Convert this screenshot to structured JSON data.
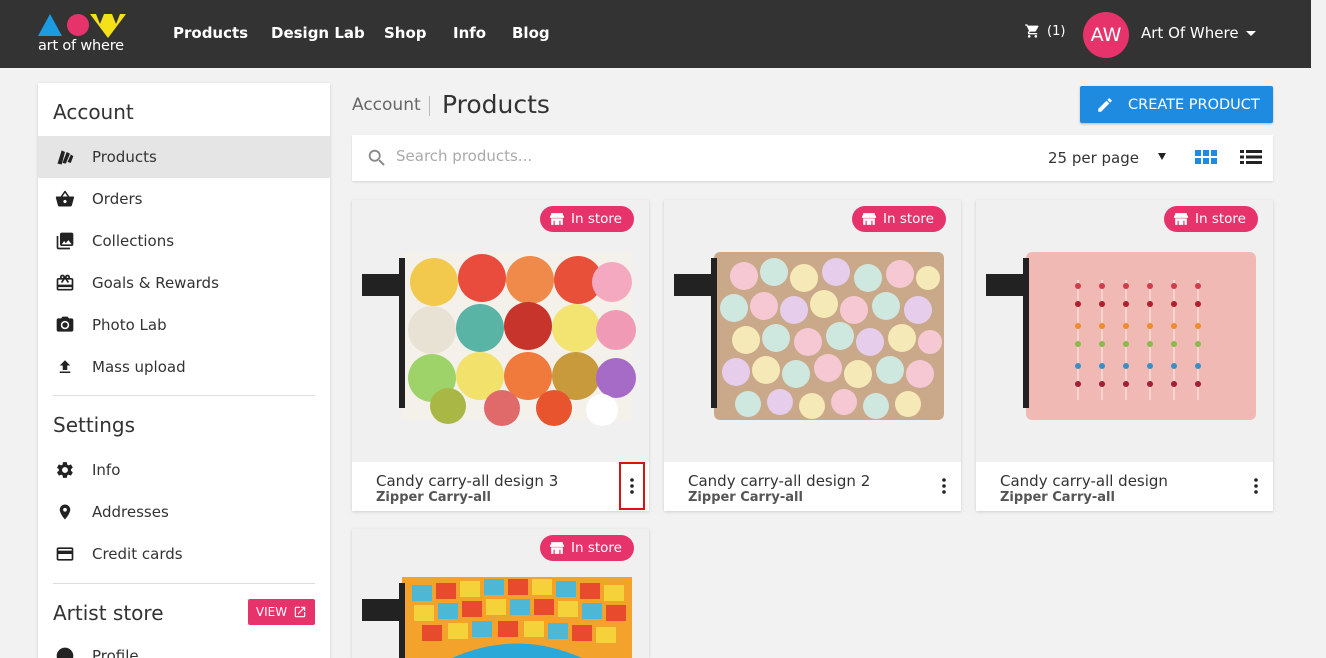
{
  "nav": {
    "logo_text": "art of where",
    "links": [
      "Products",
      "Design Lab",
      "Shop",
      "Info",
      "Blog"
    ],
    "cart_count": "(1)",
    "avatar_initials": "AW",
    "user_name": "Art Of Where"
  },
  "sidebar": {
    "account_heading": "Account",
    "account_items": [
      {
        "label": "Products",
        "icon": "swatch-icon",
        "active": true
      },
      {
        "label": "Orders",
        "icon": "basket-icon"
      },
      {
        "label": "Collections",
        "icon": "collections-icon"
      },
      {
        "label": "Goals & Rewards",
        "icon": "gift-icon"
      },
      {
        "label": "Photo Lab",
        "icon": "camera-icon"
      },
      {
        "label": "Mass upload",
        "icon": "upload-icon"
      }
    ],
    "settings_heading": "Settings",
    "settings_items": [
      {
        "label": "Info",
        "icon": "gear-icon"
      },
      {
        "label": "Addresses",
        "icon": "location-pin-icon"
      },
      {
        "label": "Credit cards",
        "icon": "credit-card-icon"
      }
    ],
    "store_heading": "Artist store",
    "view_label": "VIEW",
    "store_items": [
      {
        "label": "Profile",
        "icon": "profile-icon"
      }
    ]
  },
  "header": {
    "breadcrumb": "Account",
    "title": "Products",
    "create_label": "CREATE PRODUCT"
  },
  "search": {
    "placeholder": "Search products...",
    "per_page": "25 per page"
  },
  "products": [
    {
      "name": "Candy carry-all design 3",
      "type": "Zipper Carry-all",
      "badge": "In store"
    },
    {
      "name": "Candy carry-all design 2",
      "type": "Zipper Carry-all",
      "badge": "In store"
    },
    {
      "name": "Candy carry-all design",
      "type": "Zipper Carry-all",
      "badge": "In store"
    },
    {
      "name": "",
      "type": "",
      "badge": "In store"
    }
  ],
  "colors": {
    "topbar": "#333333",
    "accent_pink": "#e6336b",
    "accent_blue": "#1f8be0"
  }
}
